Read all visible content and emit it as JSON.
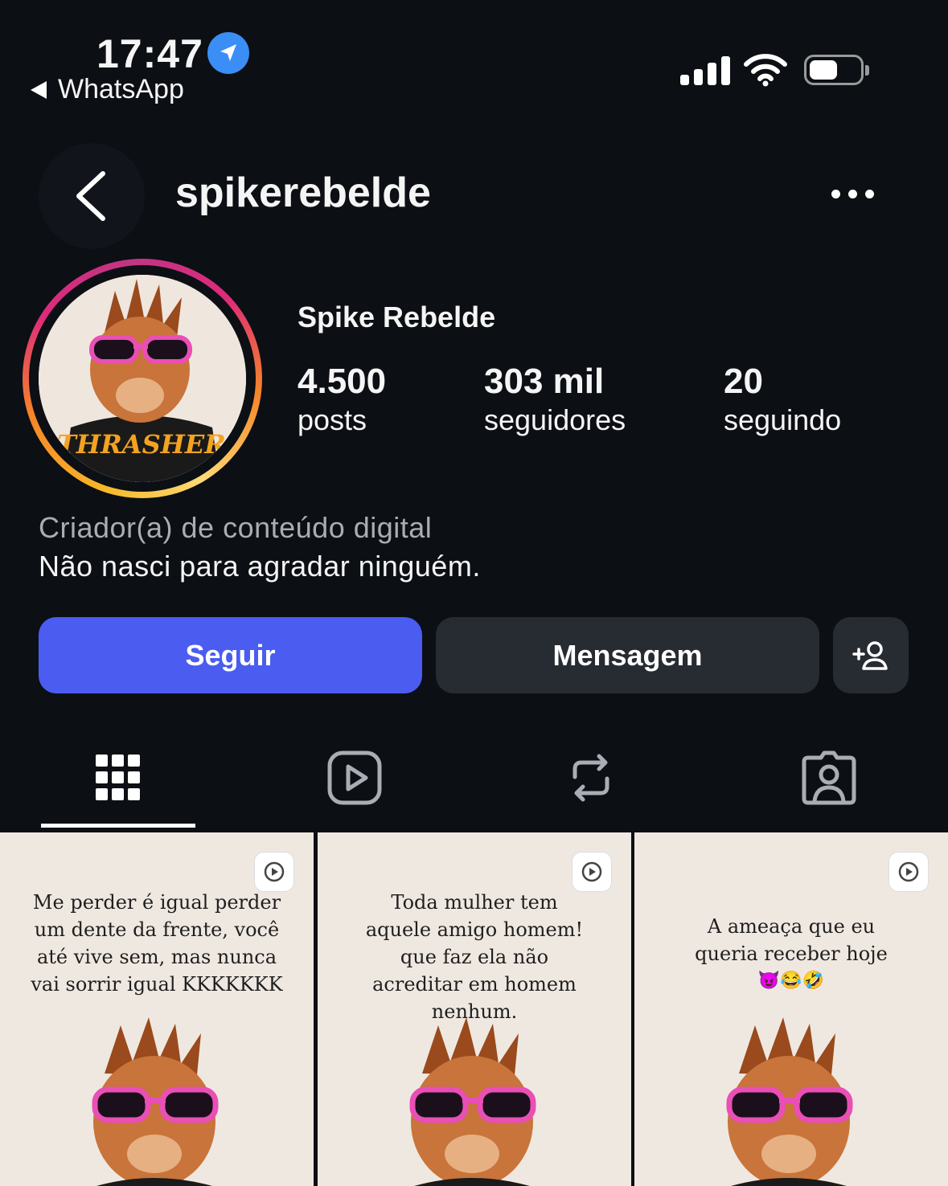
{
  "status_bar": {
    "time": "17:47",
    "back_app": "WhatsApp",
    "location_icon": "location-arrow-icon",
    "signal_icon": "cellular-signal-icon",
    "wifi_icon": "wifi-icon",
    "battery_icon": "battery-icon"
  },
  "header": {
    "username": "spikerebelde",
    "back_icon": "chevron-left-icon",
    "more_icon": "more-dots-icon"
  },
  "profile": {
    "full_name": "Spike Rebelde",
    "stats": [
      {
        "value": "4.500",
        "label": "posts"
      },
      {
        "value": "303 mil",
        "label": "seguidores"
      },
      {
        "value": "20",
        "label": "seguindo"
      }
    ],
    "category": "Criador(a) de conteúdo digital",
    "bio": "Não nasci para agradar ninguém.",
    "avatar_shirt_text": "THRASHER"
  },
  "actions": {
    "follow": "Seguir",
    "message": "Mensagem",
    "add_user_icon": "add-person-icon"
  },
  "tabs": [
    {
      "name": "grid",
      "icon": "grid-icon",
      "active": true
    },
    {
      "name": "reels",
      "icon": "reels-play-icon",
      "active": false
    },
    {
      "name": "reposts",
      "icon": "repost-icon",
      "active": false
    },
    {
      "name": "tagged",
      "icon": "tagged-person-icon",
      "active": false
    }
  ],
  "posts": [
    {
      "text": "Me perder é igual perder um dente da frente, você até vive sem, mas nunca vai sorrir igual KKKKKKK",
      "type": "reel"
    },
    {
      "text": "Toda mulher tem aquele amigo homem! que faz ela não acreditar em homem nenhum.",
      "type": "reel"
    },
    {
      "text": "A ameaça que eu queria receber hoje",
      "emoji": "😈😂🤣",
      "type": "reel"
    }
  ],
  "colors": {
    "background": "#0c0f14",
    "follow_button": "#4a5df0",
    "secondary_button": "#272b32",
    "location_badge": "#3a8ef6"
  }
}
